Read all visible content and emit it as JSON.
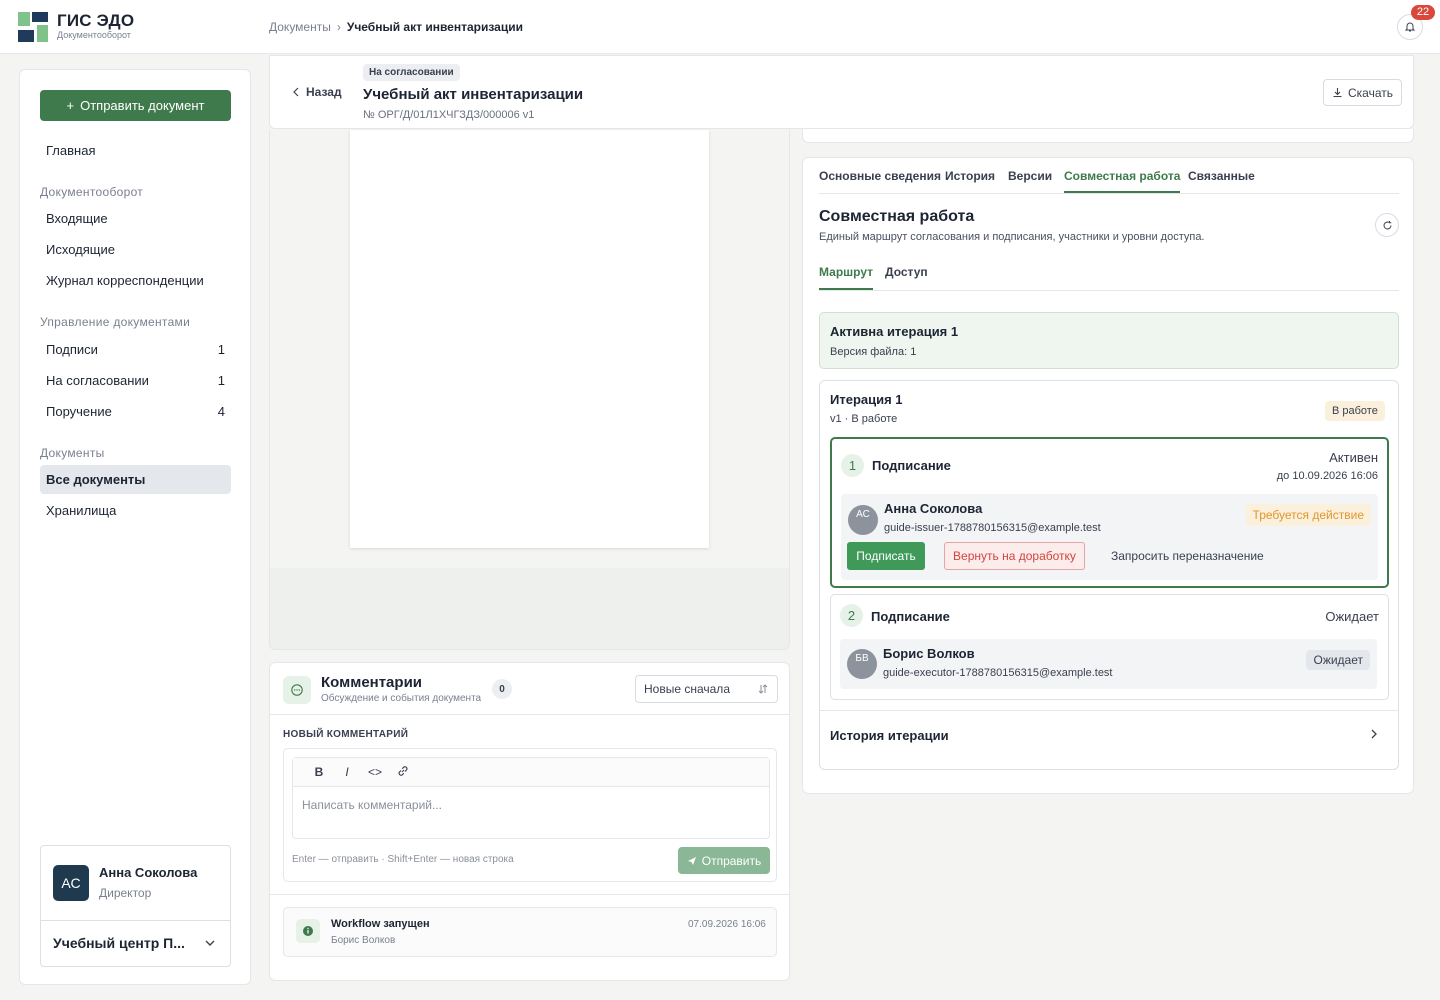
{
  "header": {
    "brand_title": "ГИС ЭДО",
    "brand_sub": "Документооборот",
    "breadcrumb": [
      "Документы",
      "Учебный акт инвентаризации"
    ],
    "notifications_count": "22"
  },
  "sidebar": {
    "send_button": "Отправить документ",
    "home": "Главная",
    "groups": {
      "workflow": "Документооборот",
      "management": "Управление документами",
      "documents": "Документы"
    },
    "workflow_items": [
      {
        "label": "Входящие"
      },
      {
        "label": "Исходящие"
      },
      {
        "label": "Журнал корреспонденции"
      }
    ],
    "management_items": [
      {
        "label": "Подписи",
        "count": "1"
      },
      {
        "label": "На согласовании",
        "count": "1"
      },
      {
        "label": "Поручение",
        "count": "4"
      }
    ],
    "document_items": [
      {
        "label": "Все документы",
        "active": true
      },
      {
        "label": "Хранилища"
      }
    ],
    "user": {
      "initials": "АС",
      "name": "Анна Соколова",
      "role": "Директор",
      "org": "Учебный центр П..."
    }
  },
  "document": {
    "back_label": "Назад",
    "status": "На согласовании",
    "title": "Учебный акт инвентаризации",
    "number": "№ ОРГ/Д/01Л1ХЧГЗДЗ/000006  v1",
    "download_label": "Скачать"
  },
  "comments": {
    "title": "Комментарии",
    "subtitle": "Обсуждение и события документа",
    "count": "0",
    "sort_value": "Новые сначала",
    "new_label": "НОВЫЙ КОММЕНТАРИЙ",
    "toolbar": {
      "bold": "B",
      "italic": "I",
      "code": "<>"
    },
    "placeholder": "Написать комментарий...",
    "hint": "Enter — отправить · Shift+Enter — новая строка",
    "send_label": "Отправить",
    "events": [
      {
        "title": "Workflow запущен",
        "author": "Борис Волков",
        "time": "07.09.2026 16:06"
      }
    ]
  },
  "panel": {
    "tabs": [
      "Основные сведения",
      "История",
      "Версии",
      "Совместная работа",
      "Связанные"
    ],
    "active_tab": 3,
    "title": "Совместная работа",
    "subtitle": "Единый маршрут согласования и подписания, участники и уровни доступа.",
    "subtabs": [
      "Маршрут",
      "Доступ"
    ],
    "active_iteration": {
      "title": "Активна итерация 1",
      "sub": "Версия файла: 1"
    },
    "iteration": {
      "title": "Итерация 1",
      "sub": "v1 · В работе",
      "badge": "В работе",
      "steps": [
        {
          "num": "1",
          "title": "Подписание",
          "status": "Активен",
          "due": "до 10.09.2026 16:06",
          "person": {
            "initials": "АС",
            "name": "Анна Соколова",
            "email": "guide-issuer-1788780156315@example.test",
            "badge": "Требуется действие"
          },
          "actions": {
            "sign": "Подписать",
            "return": "Вернуть на доработку",
            "reassign": "Запросить переназначение"
          }
        },
        {
          "num": "2",
          "title": "Подписание",
          "status": "Ожидает",
          "person": {
            "initials": "БВ",
            "name": "Борис Волков",
            "email": "guide-executor-1788780156315@example.test",
            "badge": "Ожидает"
          }
        }
      ],
      "history_label": "История итерации"
    }
  },
  "colors": {
    "accent": "#3f7a4c",
    "warning": "#e0962e",
    "danger": "#d2453a",
    "badge_red": "#d9483b"
  }
}
